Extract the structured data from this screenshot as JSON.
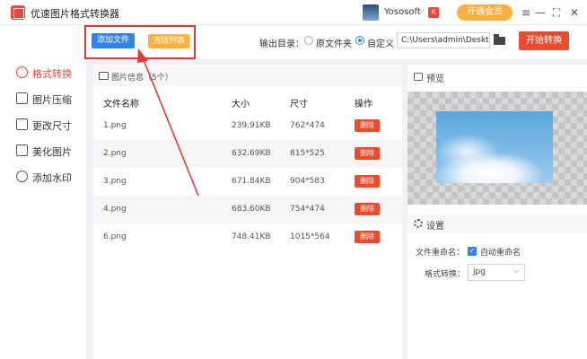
{
  "app": {
    "title": "优速图片格式转换器"
  },
  "user": {
    "name": "Yososoft",
    "caret": "⌵",
    "vip_mini": "K",
    "vip_button": "开通会员"
  },
  "window_controls": {
    "menu": "≡",
    "minimize": "—",
    "maximize": "⛶",
    "close": "✕"
  },
  "sidebar": {
    "items": [
      {
        "label": "格式转换",
        "icon": "refresh-icon",
        "active": true
      },
      {
        "label": "图片压缩",
        "icon": "compress-icon",
        "active": false
      },
      {
        "label": "更改尺寸",
        "icon": "resize-icon",
        "active": false
      },
      {
        "label": "美化图片",
        "icon": "beautify-icon",
        "active": false
      },
      {
        "label": "添加水印",
        "icon": "watermark-icon",
        "active": false
      }
    ]
  },
  "toolbar": {
    "add_file": "添加文件",
    "clear_list": "清除列表",
    "output_label": "输出目录：",
    "radio_original": "原文件夹",
    "radio_custom": "自定义",
    "path_value": "C:\\Users\\admin\\Deskto",
    "start_button": "开始转换"
  },
  "file_panel": {
    "title": "图片信息（5个）",
    "columns": [
      "文件名称",
      "大小",
      "尺寸",
      "操作"
    ],
    "delete_label": "删除",
    "rows": [
      {
        "name": "1.png",
        "size": "239.91KB",
        "dims": "762*474"
      },
      {
        "name": "2.png",
        "size": "632.69KB",
        "dims": "815*525"
      },
      {
        "name": "3.png",
        "size": "671.84KB",
        "dims": "904*583"
      },
      {
        "name": "4.png",
        "size": "683.60KB",
        "dims": "754*474"
      },
      {
        "name": "6.png",
        "size": "748.41KB",
        "dims": "1015*564"
      }
    ]
  },
  "preview": {
    "label": "预览"
  },
  "settings": {
    "label": "设置",
    "rename_label": "文件重命名：",
    "auto_rename": "自动重命名",
    "format_label": "格式转换：",
    "format_value": "jpg",
    "format_caret": "⌵"
  },
  "colors": {
    "accent_red": "#e8473a",
    "primary_blue": "#2f86e8",
    "orange": "#ffb03a",
    "annotation_red": "#e53935"
  }
}
